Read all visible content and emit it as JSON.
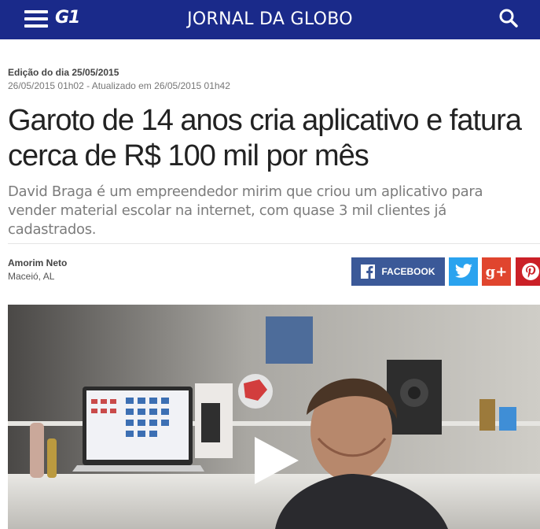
{
  "header": {
    "logo": "G1",
    "title": "JORNAL DA GLOBO",
    "menu_icon": "hamburger-menu-icon",
    "search_icon": "search-icon"
  },
  "article": {
    "edition": "Edição do dia 25/05/2015",
    "dates": "26/05/2015 01h02 - Atualizado em 26/05/2015 01h42",
    "headline": "Garoto de 14 anos cria aplicativo e fatura cerca de R$ 100 mil por mês",
    "subtitle": "David Braga é um empreendedor mirim que criou um aplicativo para vender material escolar na internet, com quase 3 mil clientes já cadastrados.",
    "author": "Amorim Neto",
    "location": "Maceió, AL"
  },
  "share": {
    "facebook_label": "FACEBOOK",
    "googleplus_label": "g+"
  },
  "colors": {
    "topbar": "#1a2a8a",
    "facebook": "#3b5998",
    "twitter": "#2aa3ef",
    "googleplus": "#e0452e",
    "pinterest": "#cb2027"
  }
}
